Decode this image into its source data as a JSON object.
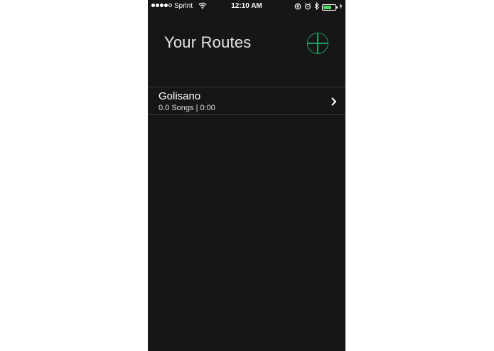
{
  "status_bar": {
    "carrier": "Sprint",
    "time": "12:10 AM",
    "signal_bars_filled": 4,
    "signal_bars_total": 5,
    "battery_level": 0.7
  },
  "header": {
    "title": "Your Routes",
    "add_icon": "plus-circle-icon"
  },
  "routes": [
    {
      "name": "Golisano",
      "meta": "0.0 Songs | 0:00",
      "icon": "chevron-right-icon"
    }
  ],
  "colors": {
    "background": "#161616",
    "accent": "#1e9e5e",
    "battery": "#4cd964"
  }
}
